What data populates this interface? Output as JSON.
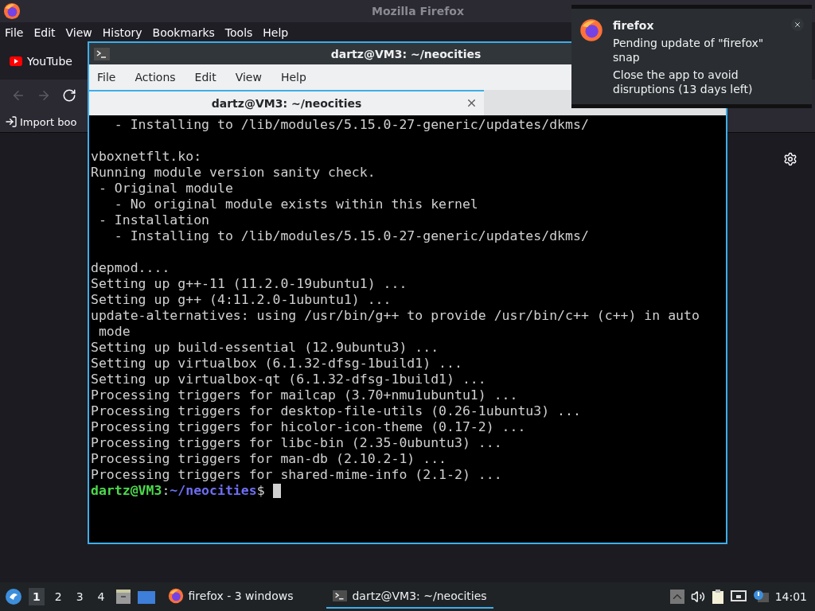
{
  "browser": {
    "title": "Mozilla Firefox",
    "menu": [
      "File",
      "Edit",
      "View",
      "History",
      "Bookmarks",
      "Tools",
      "Help"
    ],
    "tabs": [
      {
        "label": "YouTube",
        "selected": false
      }
    ],
    "bookmarks": [
      "Import boo"
    ]
  },
  "terminal": {
    "title": "dartz@VM3: ~/neocities",
    "menu": [
      "File",
      "Actions",
      "Edit",
      "View",
      "Help"
    ],
    "tabs": [
      {
        "label": "dartz@VM3: ~/neocities",
        "selected": true
      }
    ],
    "blocks": [
      [
        "   - Installing to /lib/modules/5.15.0-27-generic/updates/dkms/"
      ],
      [
        "vboxnetflt.ko:",
        "Running module version sanity check.",
        " - Original module",
        "   - No original module exists within this kernel",
        " - Installation",
        "   - Installing to /lib/modules/5.15.0-27-generic/updates/dkms/"
      ],
      [
        "depmod....",
        "Setting up g++-11 (11.2.0-19ubuntu1) ...",
        "Setting up g++ (4:11.2.0-1ubuntu1) ...",
        "update-alternatives: using /usr/bin/g++ to provide /usr/bin/c++ (c++) in auto",
        " mode",
        "Setting up build-essential (12.9ubuntu3) ...",
        "Setting up virtualbox (6.1.32-dfsg-1build1) ...",
        "Setting up virtualbox-qt (6.1.32-dfsg-1build1) ...",
        "Processing triggers for mailcap (3.70+nmu1ubuntu1) ...",
        "Processing triggers for desktop-file-utils (0.26-1ubuntu3) ...",
        "Processing triggers for hicolor-icon-theme (0.17-2) ...",
        "Processing triggers for libc-bin (2.35-0ubuntu3) ...",
        "Processing triggers for man-db (2.10.2-1) ...",
        "Processing triggers for shared-mime-info (2.1-2) ..."
      ]
    ],
    "prompt": {
      "user_host": "dartz@VM3",
      "separator": ":",
      "path": "~/neocities",
      "symbol": "$"
    }
  },
  "notification": {
    "app": "firefox",
    "message": "Pending update of \"firefox\" snap",
    "detail": "Close the app to avoid disruptions (13 days left)"
  },
  "taskbar": {
    "workspaces": [
      {
        "label": "1",
        "selected": true
      },
      {
        "label": "2",
        "selected": false
      },
      {
        "label": "3",
        "selected": false
      },
      {
        "label": "4",
        "selected": false
      }
    ],
    "tasks": [
      {
        "kind": "firefox",
        "label": "firefox - 3 windows",
        "selected": false
      },
      {
        "kind": "terminal",
        "label": "dartz@VM3: ~/neocities",
        "selected": true
      }
    ],
    "clock": "14:01"
  }
}
